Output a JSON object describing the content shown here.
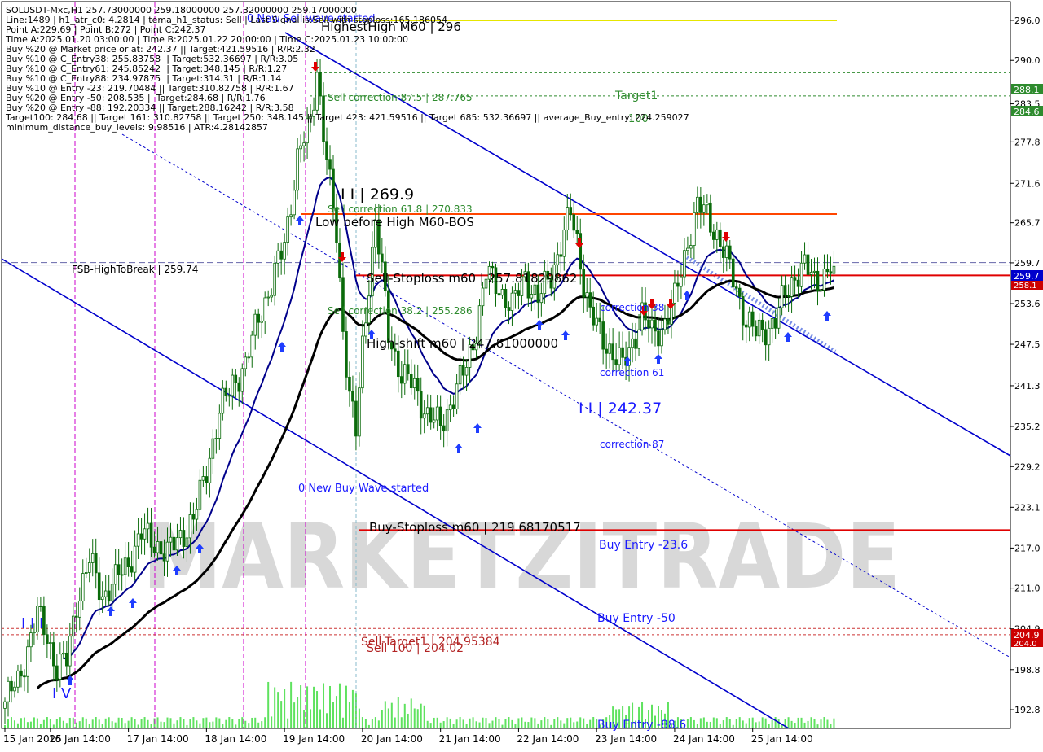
{
  "colors": {
    "background": "#ffffff",
    "bull_candle": "#0b6b0b",
    "bear_candle": "#0b6b0b",
    "channel": "#0000cc",
    "ma_blue": "#00008b",
    "ma_black": "#000000",
    "level_red": "#e00000",
    "level_yellow": "#e6e600",
    "target_green": "#2e8b2e",
    "text_dark": "#000000",
    "text_blue": "#1a1aff",
    "text_brown": "#b22222",
    "volume": "#5fe25f",
    "sep_magenta": "#cc00cc",
    "price_tag_red": "#cc0000",
    "price_tag_blue": "#0000cc",
    "price_tag_green": "#2e8b2e",
    "watermark": "#d8d8d8"
  },
  "header_lines": [
    "SOLUSDT-Mxc,H1  257.73000000 259.18000000 257.32000000 259.17000000",
    "Line:1489 | h1_atr_c0: 4.2814 | tema_h1_status: Sell | Last Signal is:Sell with stoploss:165.186054",
    "Point A:229.69 | Point B:272 | Point C:242.37",
    "Time A:2025.01.20 03:00:00 | Time B:2025.01.22 20:00:00 | Time C:2025.01.23 10:00:00",
    "Buy %20 @ Market price or at: 242.37 || Target:421.59516 | R/R:2.32",
    "Buy %10 @ C_Entry38: 255.83758 || Target:532.36697 | R/R:3.05",
    "Buy %10 @ C_Entry61: 245.85242 || Target:348.145 | R/R:1.27",
    "Buy %10 @ C_Entry88: 234.97875 || Target:314.31 | R/R:1.14",
    "Buy %10 @ Entry -23: 219.70484 || Target:310.82758 | R/R:1.67",
    "Buy %20 @ Entry -50: 208.535 || Target:284.68 | R/R:1.76",
    "Buy %20 @ Entry -88: 192.20334 || Target:288.16242 | R/R:3.58",
    "Target100: 284.68 || Target 161: 310.82758 || Target 250: 348.145 || Target 423: 421.59516 || Target 685: 532.36697 || average_Buy_entry: 224.259027",
    "minimum_distance_buy_levels: 9.98516 | ATR:4.28142857"
  ],
  "labels": {
    "new_sell_wave": "0 New Sell wave started",
    "highest_high": "HighestHigh   M60 | 296",
    "target1": "Target1",
    "target100": "100",
    "sell_corr_875": "Sell correction 87.5 | 287.765",
    "point_b": "I I | 269.9",
    "sell_corr_618": "Sell correction 61.8 | 270.833",
    "low_before_high": "Low before High   M60-BOS",
    "fsb": "FSB-HighToBreak | 259.74",
    "sell_stoploss": "Sell-Stoploss m60 | 257.81829862",
    "sell_corr_382": "Sell correction 38.2 | 255.286",
    "high_shift": "High-shift m60 | 247.81000000",
    "correction38": "correction 38",
    "correction61": "correction 61",
    "point_c": "I I | 242.37",
    "correction87": "correction 87",
    "new_buy_wave": "0 New Buy Wave started",
    "buy_stoploss": "Buy-Stoploss m60 | 219.68170517",
    "buy_entry_23": "Buy Entry -23.6",
    "buy_entry_50": "Buy Entry -50",
    "buy_entry_88": "Buy Entry -88.6",
    "sell_target1": "Sell-Target1 | 204.95384",
    "sell_100": "Sell 100 | 204.02",
    "wave_iii": "I I I",
    "wave_iv": "I V",
    "watermark": "MARKETZITRADE"
  },
  "price_tags": {
    "t1": "288.1",
    "t100": "284.6",
    "last": "259.7",
    "st": "258.1",
    "s204a": "204.9",
    "s204b": "204.0"
  },
  "chart_data": {
    "type": "candlestick",
    "symbol": "SOLUSDT-Mxc",
    "timeframe": "H1",
    "ylim": [
      190.0,
      298.8
    ],
    "ytick_labels": [
      "296.0",
      "290.0",
      "283.5",
      "277.8",
      "271.6",
      "265.7",
      "259.7",
      "253.6",
      "247.5",
      "241.3",
      "235.2",
      "229.2",
      "223.1",
      "217.0",
      "211.0",
      "204.9",
      "198.8",
      "192.8"
    ],
    "x_labels": [
      "15 Jan 2025",
      "16 Jan 14:00",
      "17 Jan 14:00",
      "18 Jan 14:00",
      "19 Jan 14:00",
      "20 Jan 14:00",
      "21 Jan 14:00",
      "22 Jan 14:00",
      "23 Jan 14:00",
      "24 Jan 14:00",
      "25 Jan 14:00"
    ],
    "anchors": [
      [
        0,
        194
      ],
      [
        4,
        197
      ],
      [
        7,
        202
      ],
      [
        10,
        207
      ],
      [
        13,
        204
      ],
      [
        16,
        199
      ],
      [
        19,
        200
      ],
      [
        22,
        209
      ],
      [
        26,
        215
      ],
      [
        30,
        210
      ],
      [
        34,
        212
      ],
      [
        38,
        215
      ],
      [
        42,
        219
      ],
      [
        46,
        218
      ],
      [
        50,
        216
      ],
      [
        54,
        219
      ],
      [
        58,
        221
      ],
      [
        62,
        229
      ],
      [
        66,
        237
      ],
      [
        70,
        242
      ],
      [
        74,
        244
      ],
      [
        78,
        252
      ],
      [
        82,
        256
      ],
      [
        86,
        263
      ],
      [
        90,
        275
      ],
      [
        94,
        281
      ],
      [
        96,
        289
      ],
      [
        98,
        279
      ],
      [
        100,
        271
      ],
      [
        102,
        264
      ],
      [
        104,
        250
      ],
      [
        106,
        240
      ],
      [
        108,
        234
      ],
      [
        110,
        247
      ],
      [
        112,
        257
      ],
      [
        114,
        266
      ],
      [
        116,
        258
      ],
      [
        118,
        249
      ],
      [
        120,
        246
      ],
      [
        122,
        243
      ],
      [
        126,
        241
      ],
      [
        130,
        237
      ],
      [
        134,
        235
      ],
      [
        138,
        240
      ],
      [
        142,
        244
      ],
      [
        145,
        250
      ],
      [
        148,
        258
      ],
      [
        152,
        256
      ],
      [
        156,
        253
      ],
      [
        160,
        258
      ],
      [
        164,
        254
      ],
      [
        168,
        258
      ],
      [
        172,
        264
      ],
      [
        174,
        267
      ],
      [
        176,
        263
      ],
      [
        178,
        257
      ],
      [
        180,
        252
      ],
      [
        183,
        249
      ],
      [
        186,
        247
      ],
      [
        190,
        244
      ],
      [
        193,
        248
      ],
      [
        196,
        252
      ],
      [
        199,
        249
      ],
      [
        202,
        250
      ],
      [
        206,
        254
      ],
      [
        210,
        263
      ],
      [
        213,
        268
      ],
      [
        216,
        267
      ],
      [
        219,
        264
      ],
      [
        222,
        260
      ],
      [
        225,
        256
      ],
      [
        228,
        251
      ],
      [
        231,
        249
      ],
      [
        234,
        250
      ],
      [
        237,
        251
      ],
      [
        240,
        255
      ],
      [
        243,
        258
      ],
      [
        246,
        259
      ],
      [
        249,
        257
      ],
      [
        252,
        258
      ],
      [
        255,
        259.2
      ]
    ],
    "levels": {
      "highest_high": 296,
      "target1": 288.16,
      "target100": 284.68,
      "low_before_high": 267.0,
      "fsb_high_to_break": 259.74,
      "sell_stoploss": 257.82,
      "buy_stoploss": 219.68,
      "sell_target1": 204.95,
      "sell_100": 204.02
    },
    "points": {
      "A": 229.69,
      "B": 272,
      "C": 242.37
    },
    "ohlc_last": {
      "open": 257.73,
      "high": 259.18,
      "low": 257.32,
      "close": 259.17
    }
  }
}
